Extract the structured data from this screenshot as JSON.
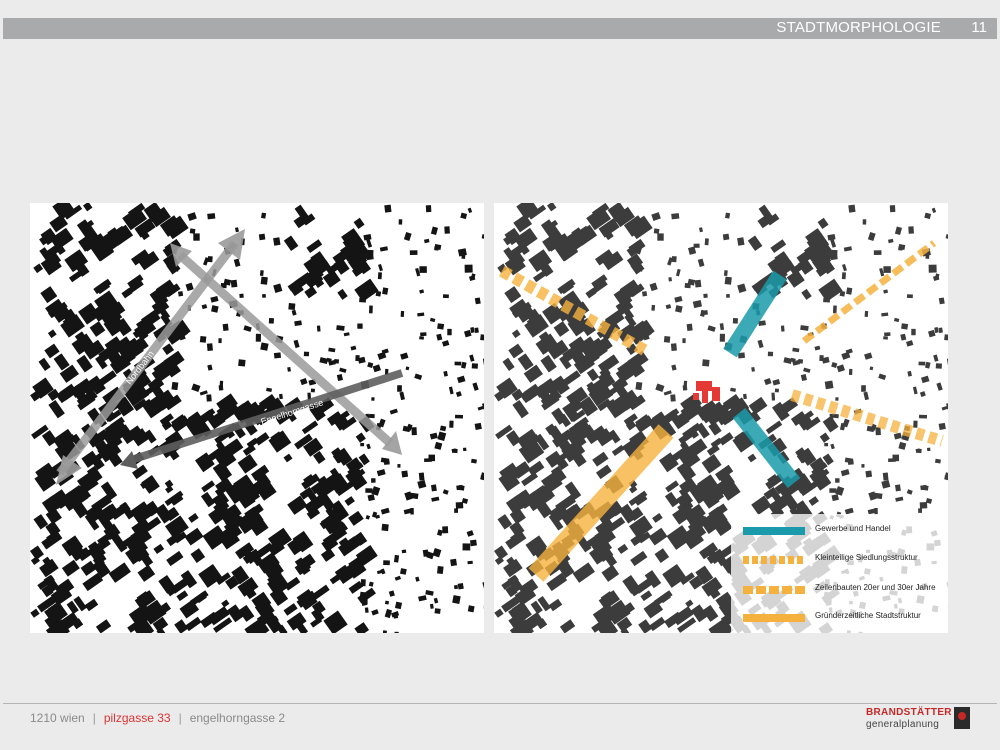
{
  "header": {
    "title": "STADTMORPHOLOGIE",
    "page_number": "11"
  },
  "left_map": {
    "arrow_labels": [
      "Nordbahn",
      "…",
      "Engelhorngasse"
    ]
  },
  "right_map": {
    "legend": [
      {
        "label": "Gewerbe und Handel",
        "color": "#1a9aaa",
        "style": "solid"
      },
      {
        "label": "Kleinteilige Siedlungsstruktur",
        "color": "#f5b13d",
        "style": "dashed"
      },
      {
        "label": "Zeilenbauten 20er und 30er Jahre",
        "color": "#f5b13d",
        "style": "dashed"
      },
      {
        "label": "Gründerzeitliche Stadtstruktur",
        "color": "#f5b13d",
        "style": "solid"
      }
    ]
  },
  "footer": {
    "district": "1210 wien",
    "separator": "|",
    "street_a": "pilzgasse 33",
    "street_b": "engelhorngasse 2"
  },
  "logo": {
    "line1": "BRANDSTÄTTER",
    "line2": "generalplanung"
  }
}
